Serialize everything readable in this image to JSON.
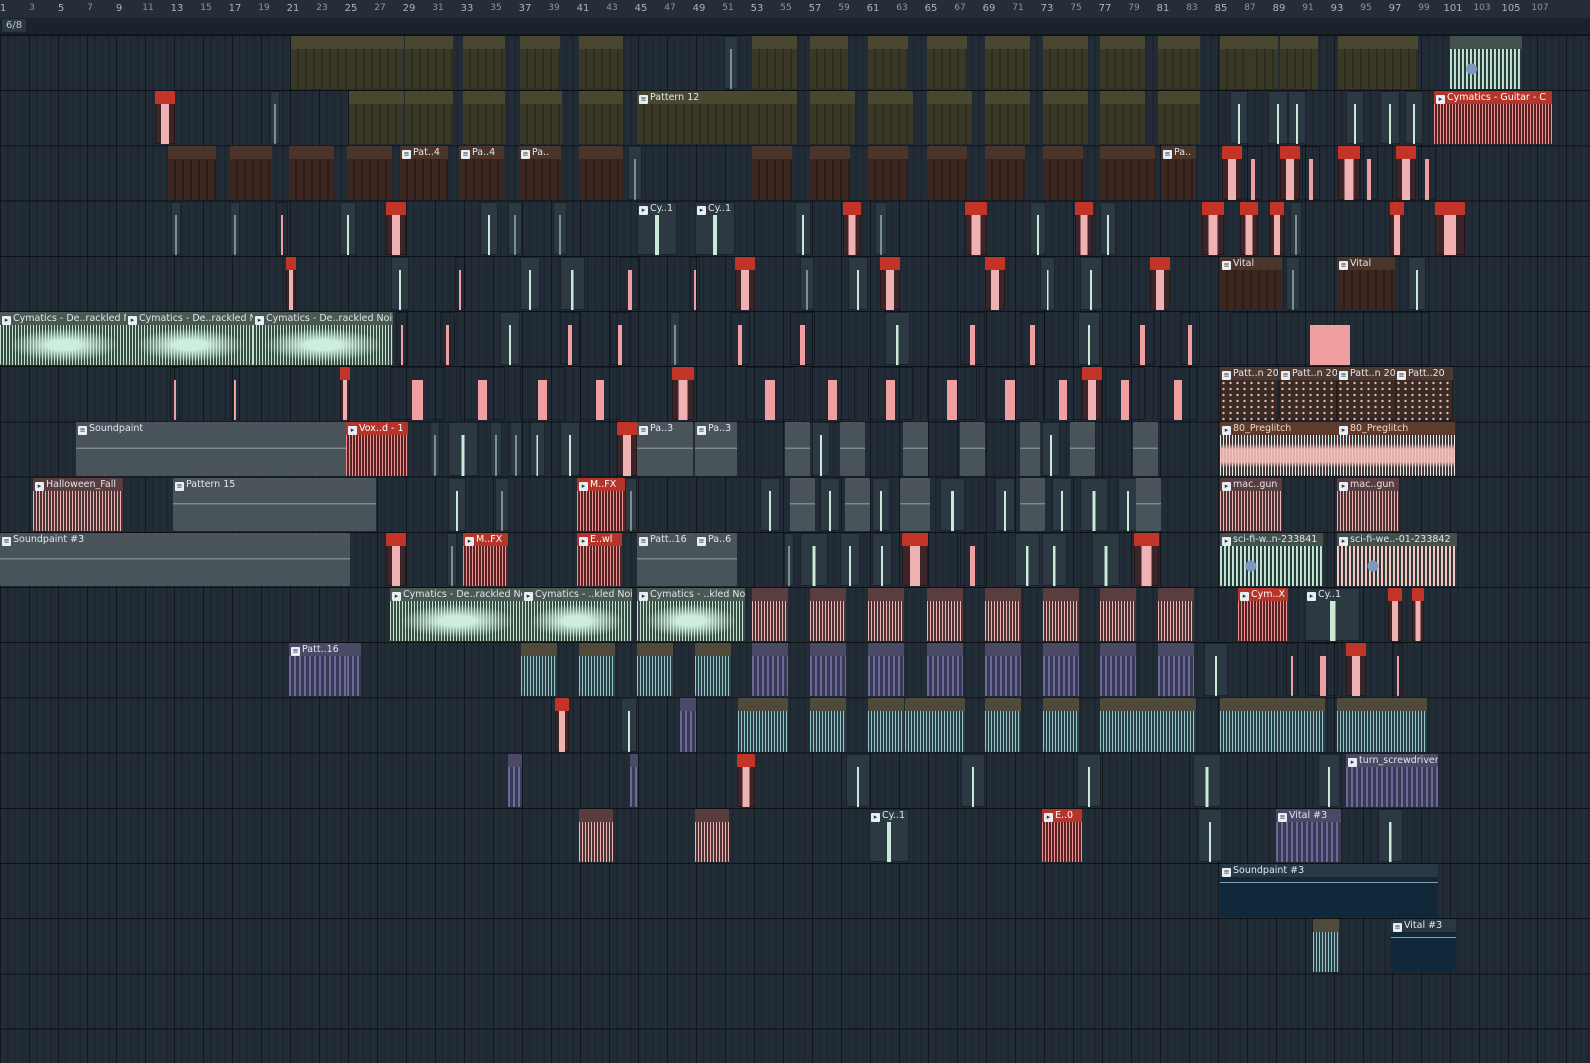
{
  "ruler": {
    "major": [
      "1",
      "5",
      "9",
      "13",
      "17",
      "21",
      "25",
      "29",
      "33",
      "37",
      "41",
      "45",
      "49",
      "53",
      "57",
      "61",
      "65",
      "69",
      "73",
      "77",
      "81",
      "85",
      "89",
      "93",
      "97",
      "101",
      "105"
    ],
    "minor": [
      "3",
      "7",
      "11",
      "15",
      "19",
      "23",
      "27",
      "31",
      "35",
      "39",
      "43",
      "47",
      "51",
      "55",
      "59",
      "63",
      "67",
      "71",
      "75",
      "79",
      "83",
      "87",
      "91",
      "95",
      "99",
      "103",
      "107"
    ]
  },
  "counter": "6/8",
  "colors": {
    "background": "#1f2a33",
    "ruler": "#252e37",
    "accent_red": "#c23328",
    "mint_wave": "#cdeedd",
    "pink_wave": "#f0b3b0"
  },
  "clips": [
    {
      "label": "Pattern 12",
      "style": "c-pattern-olive",
      "icon": "pattern-icon"
    },
    {
      "label": "Cymatics - Guitar - C",
      "style": "c-audio-red",
      "icon": "audio-icon"
    },
    {
      "label": "Pat..4",
      "style": "c-pattern-brown",
      "icon": "pattern-icon"
    },
    {
      "label": "Pa..4",
      "style": "c-pattern-brown",
      "icon": "pattern-icon"
    },
    {
      "label": "Pa..",
      "style": "c-pattern-brown",
      "icon": "pattern-icon"
    },
    {
      "label": "Pa..",
      "style": "c-pattern-brown",
      "icon": "pattern-icon"
    },
    {
      "label": "Cy..1",
      "style": "c-small",
      "icon": "audio-icon"
    },
    {
      "label": "Cy..1",
      "style": "c-small",
      "icon": "audio-icon"
    },
    {
      "label": "Vital",
      "style": "c-pattern-brown",
      "icon": "pattern-icon"
    },
    {
      "label": "Vital",
      "style": "c-pattern-brown",
      "icon": "pattern-icon"
    },
    {
      "label": "Cymatics - De..rackled No",
      "style": "c-audio-mint",
      "icon": "audio-icon"
    },
    {
      "label": "Cymatics - De..rackled No",
      "style": "c-audio-mint",
      "icon": "audio-icon"
    },
    {
      "label": "Cymatics - De..rackled Noise",
      "style": "c-audio-mint",
      "icon": "audio-icon"
    },
    {
      "label": "Patt..n 20",
      "style": "c-dots",
      "icon": "pattern-icon"
    },
    {
      "label": "Patt..n 20",
      "style": "c-dots",
      "icon": "pattern-icon"
    },
    {
      "label": "Patt..n 20",
      "style": "c-dots",
      "icon": "pattern-icon"
    },
    {
      "label": "Patt..20",
      "style": "c-dots",
      "icon": "pattern-icon"
    },
    {
      "label": "Soundpaint",
      "style": "c-sound-gray",
      "icon": "pattern-icon"
    },
    {
      "label": "Vox..d - 1",
      "style": "c-audio-red",
      "icon": "audio-icon"
    },
    {
      "label": "Pa..3",
      "style": "c-sound-gray",
      "icon": "pattern-icon"
    },
    {
      "label": "Pa..3",
      "style": "c-sound-gray",
      "icon": "pattern-icon"
    },
    {
      "label": "80_Preglitch",
      "style": "c-glitch",
      "icon": "audio-icon"
    },
    {
      "label": "80_Preglitch",
      "style": "c-glitch",
      "icon": "audio-icon"
    },
    {
      "label": "Halloween_Fall",
      "style": "c-audio-pink",
      "icon": "audio-icon"
    },
    {
      "label": "Pattern 15",
      "style": "c-sound-gray",
      "icon": "pattern-icon"
    },
    {
      "label": "M..FX",
      "style": "c-audio-red",
      "icon": "audio-icon"
    },
    {
      "label": "mac..gun",
      "style": "c-audio-pink",
      "icon": "audio-icon"
    },
    {
      "label": "mac..gun",
      "style": "c-audio-pink",
      "icon": "audio-icon"
    },
    {
      "label": "Soundpaint #3",
      "style": "c-sound-gray",
      "icon": "pattern-icon"
    },
    {
      "label": "M..FX",
      "style": "c-audio-red",
      "icon": "audio-icon"
    },
    {
      "label": "E..wl",
      "style": "c-audio-red",
      "icon": "audio-icon"
    },
    {
      "label": "Patt..16",
      "style": "c-sound-gray",
      "icon": "pattern-icon"
    },
    {
      "label": "Pa..6",
      "style": "c-sound-gray",
      "icon": "pattern-icon"
    },
    {
      "label": "sci-fi-w..n-233841",
      "style": "c-scifi",
      "icon": "audio-icon"
    },
    {
      "label": "sci-fi-we..-01-233842",
      "style": "c-scifi",
      "icon": "audio-icon"
    },
    {
      "label": "Cymatics - De..rackled Noi",
      "style": "c-audio-mint",
      "icon": "audio-icon"
    },
    {
      "label": "Cymatics - ..kled Noi",
      "style": "c-audio-mint",
      "icon": "audio-icon"
    },
    {
      "label": "Cymatics - ..kled Noise",
      "style": "c-audio-mint",
      "icon": "audio-icon"
    },
    {
      "label": "Cym..X",
      "style": "c-audio-red",
      "icon": "audio-icon"
    },
    {
      "label": "Cy..1",
      "style": "c-small",
      "icon": "audio-icon"
    },
    {
      "label": "Patt..16",
      "style": "c-pattern-purple",
      "icon": "pattern-icon"
    },
    {
      "label": "turn_screwdriver",
      "style": "c-pattern-purple",
      "icon": "audio-icon"
    },
    {
      "label": "Cy..1",
      "style": "c-small",
      "icon": "audio-icon"
    },
    {
      "label": "E..0",
      "style": "c-audio-red",
      "icon": "audio-icon"
    },
    {
      "label": "Vital #3",
      "style": "c-pattern-purple",
      "icon": "pattern-icon"
    },
    {
      "label": "Soundpaint #3",
      "style": "c-navy",
      "icon": "pattern-icon"
    },
    {
      "label": "Vital #3",
      "style": "c-navy",
      "icon": "pattern-icon"
    }
  ]
}
